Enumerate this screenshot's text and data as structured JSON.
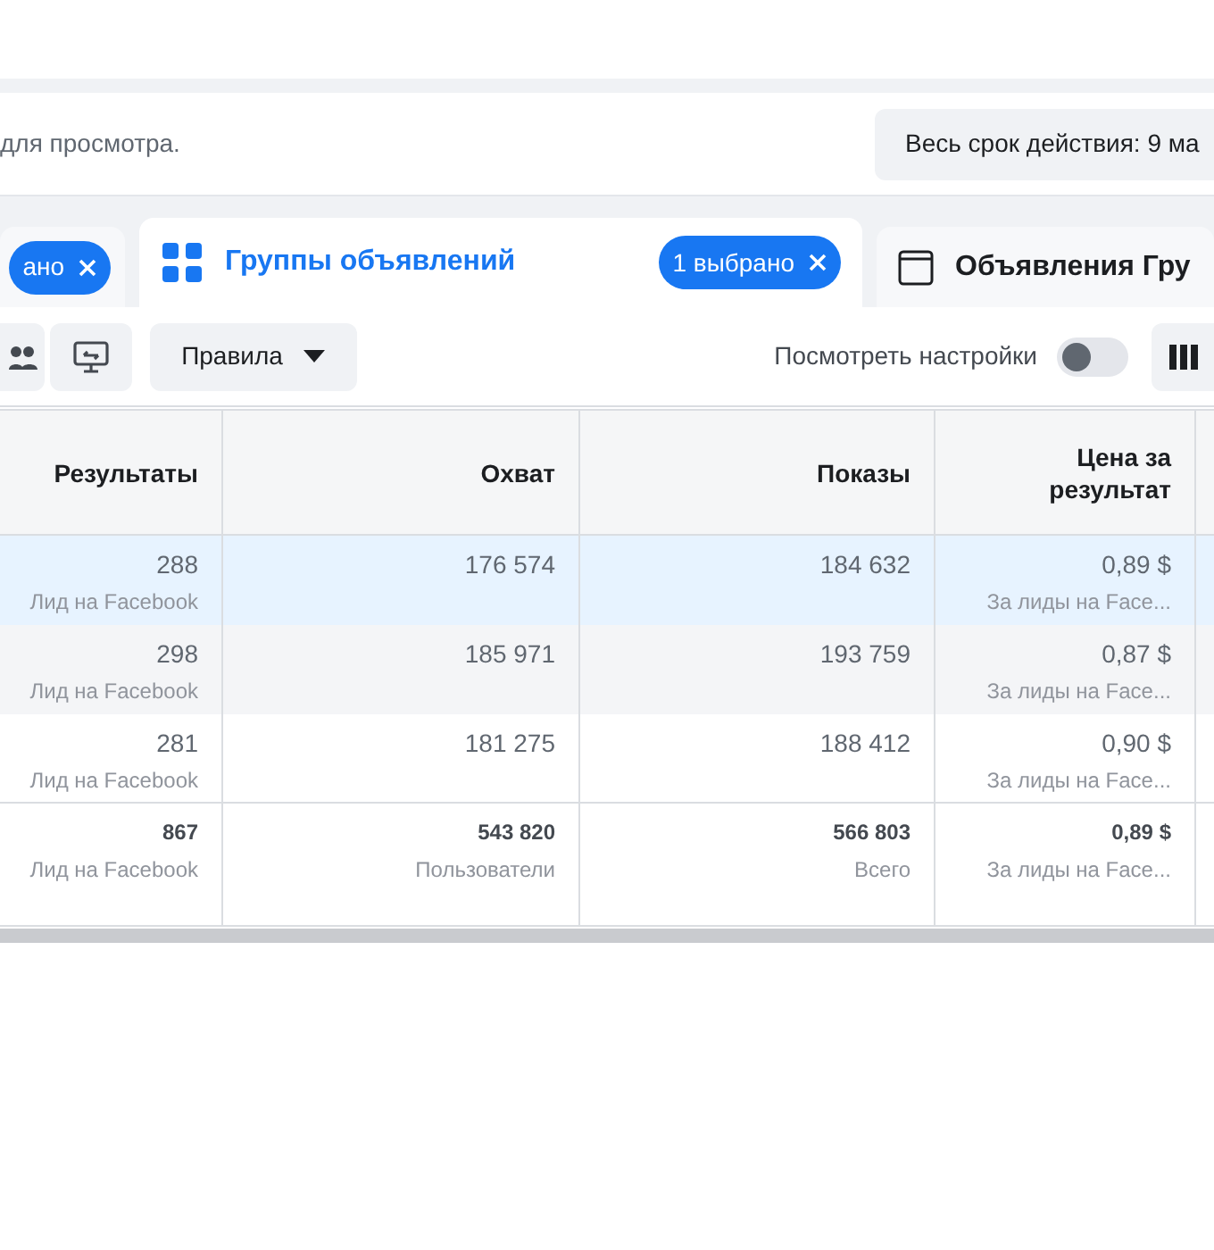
{
  "header": {
    "hint": "для просмотра.",
    "date_button": "Весь срок действия: 9 ма"
  },
  "tabs": [
    {
      "kind": "cut",
      "chip": "ано",
      "selected": false
    },
    {
      "kind": "full",
      "label": "Группы объявлений",
      "chip": "1 выбрано",
      "selected": true
    },
    {
      "kind": "plain",
      "label": "Объявления Гру",
      "selected": false
    }
  ],
  "toolbar": {
    "rules_button": "Правила",
    "view_settings": {
      "label": "Посмотреть настройки",
      "on": false
    }
  },
  "table": {
    "columns": [
      "Результаты",
      "Охват",
      "Показы",
      "Цена за результат"
    ],
    "rows": [
      {
        "selected": true,
        "cells": [
          [
            "288",
            "Лид на Facebook"
          ],
          [
            "176 574"
          ],
          [
            "184 632"
          ],
          [
            "0,89 $",
            "За лиды на Face..."
          ]
        ]
      },
      {
        "selected": false,
        "cells": [
          [
            "298",
            "Лид на Facebook"
          ],
          [
            "185 971"
          ],
          [
            "193 759"
          ],
          [
            "0,87 $",
            "За лиды на Face..."
          ]
        ]
      },
      {
        "selected": false,
        "cells": [
          [
            "281",
            "Лид на Facebook"
          ],
          [
            "181 275"
          ],
          [
            "188 412"
          ],
          [
            "0,90 $",
            "За лиды на Face..."
          ]
        ]
      }
    ],
    "total": [
      [
        "867",
        "Лид на Facebook"
      ],
      [
        "543 820",
        "Пользователи"
      ],
      [
        "566 803",
        "Всего"
      ],
      [
        "0,89 $",
        "За лиды на Face..."
      ]
    ]
  }
}
